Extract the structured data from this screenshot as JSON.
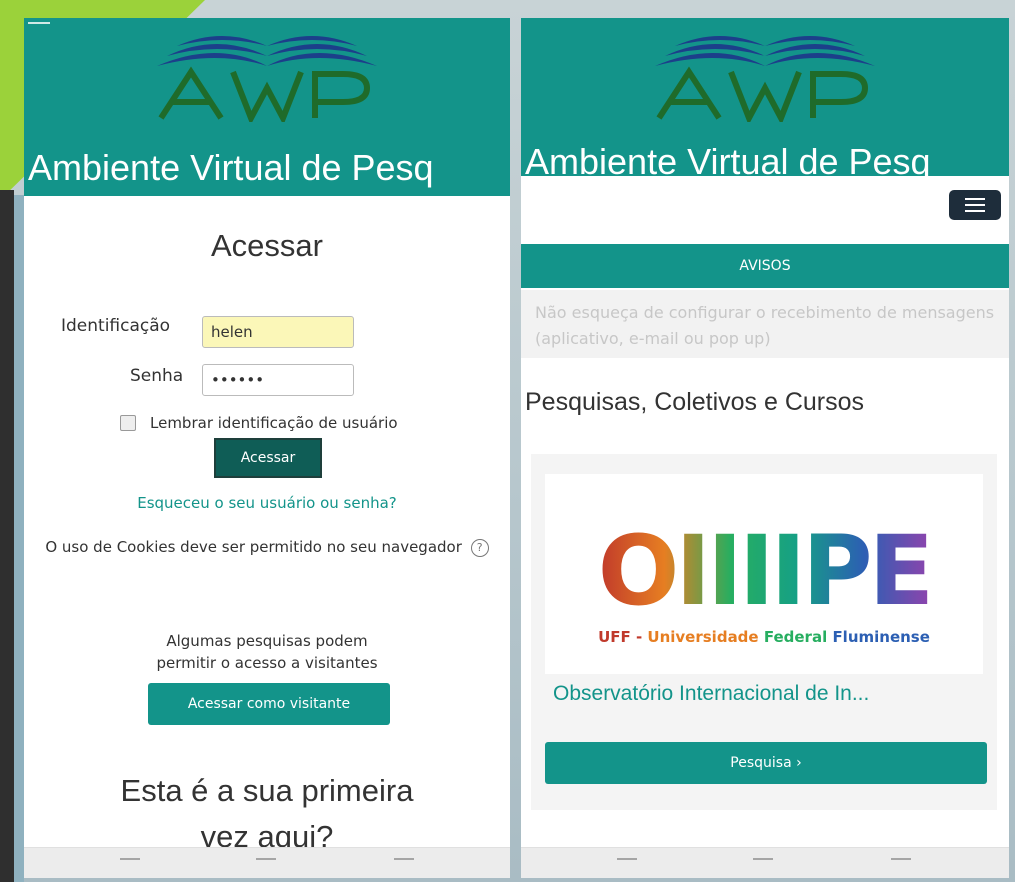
{
  "site": {
    "title": "Ambiente Virtual de Pesq",
    "logo_text": "AVP"
  },
  "login": {
    "heading": "Acessar",
    "username_label": "Identificação",
    "username_value": "helen",
    "password_label": "Senha",
    "password_value": "••••••",
    "remember_label": "Lembrar identificação de usuário",
    "submit_label": "Acessar",
    "forgot_link": "Esqueceu o seu usuário ou senha?",
    "cookie_notice": "O uso de Cookies deve ser permitido no seu navegador",
    "visitor_text_line1": "Algumas pesquisas podem",
    "visitor_text_line2": "permitir o acesso a visitantes",
    "visitor_button": "Acessar como visitante",
    "first_time_line1": "Esta é a sua primeira",
    "first_time_line2": "vez aqui?"
  },
  "home": {
    "avisos_label": "AVISOS",
    "notice_text": "Não esqueça de configurar o recebimento de mensagens (aplicativo, e-mail ou pop up)",
    "section_title": "Pesquisas, Coletivos e Cursos",
    "card": {
      "logo_word": "OIIIIPE",
      "logo_subtitle_parts": [
        "UFF - ",
        "Universidade ",
        "Federal ",
        "Fluminense"
      ],
      "title": "Observatório Internacional de In...",
      "button_label": "Pesquisa ›"
    }
  },
  "colors": {
    "brand_teal": "#13948a",
    "dark_button": "#0f5d56",
    "logo_green": "#1f6b2a",
    "logo_blue": "#1c3f8a"
  }
}
